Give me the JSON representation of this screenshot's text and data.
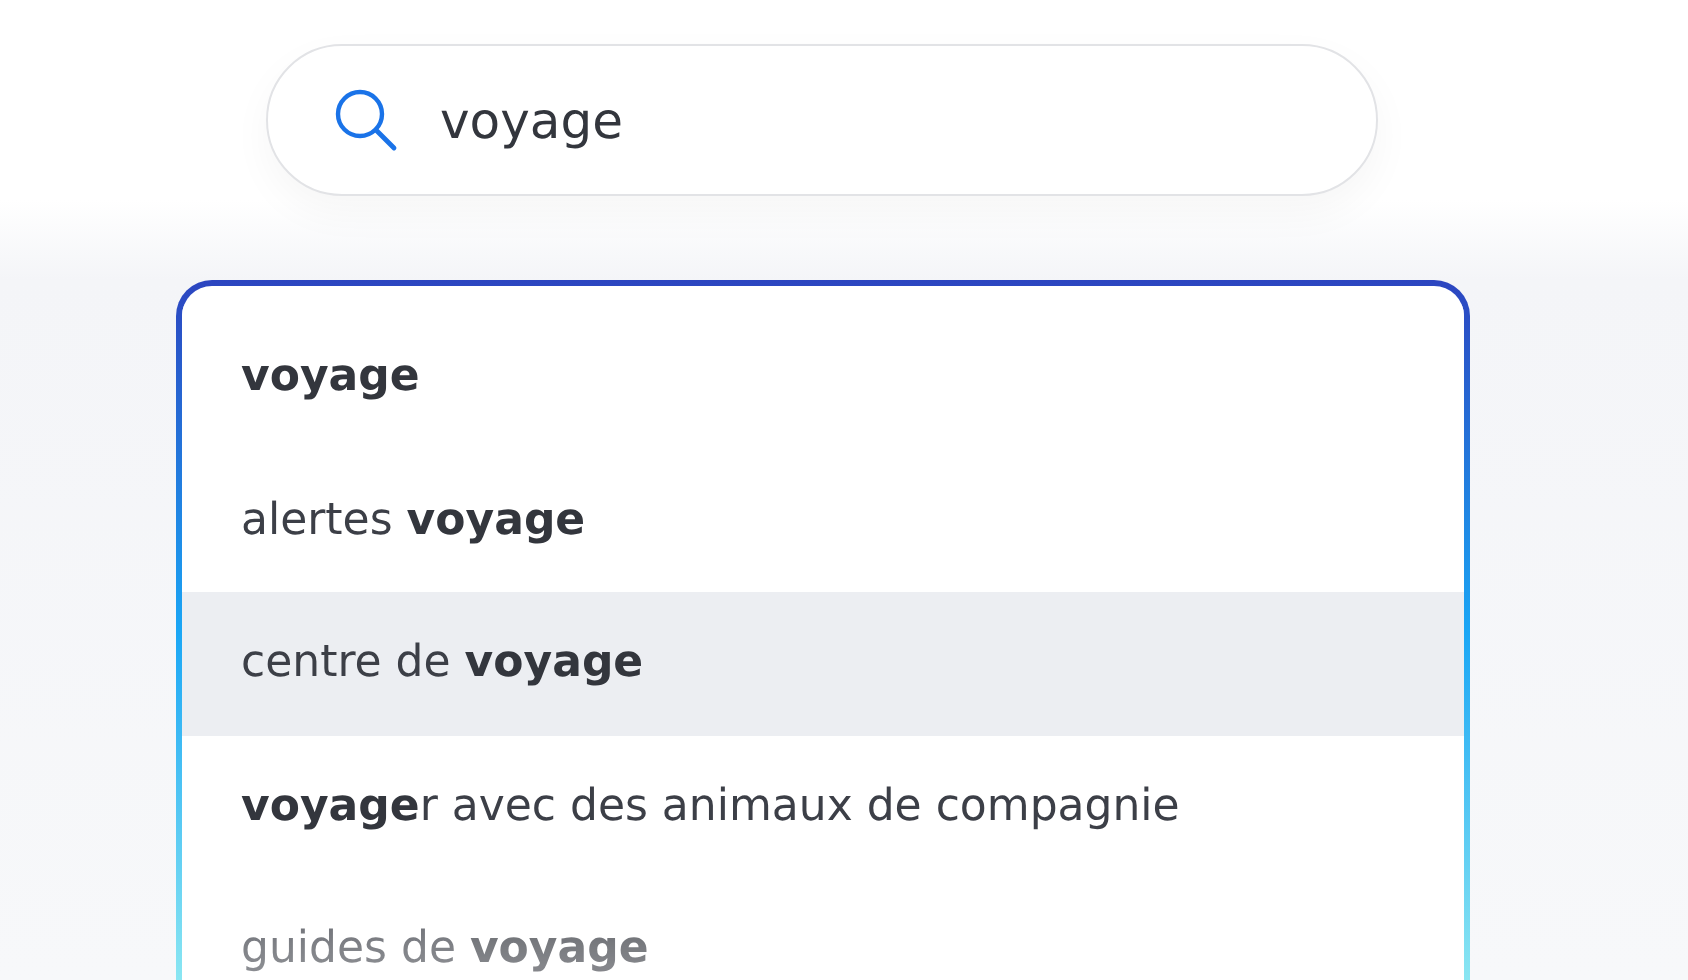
{
  "search": {
    "value": "voyage"
  },
  "suggestions": [
    {
      "text": "**voyage**",
      "selected": false
    },
    {
      "text": "alertes **voyage**",
      "selected": false
    },
    {
      "text": "centre de **voyage**",
      "selected": true
    },
    {
      "text": "**voyage**r avec des animaux de compagnie",
      "selected": false
    },
    {
      "text": "guides de **voyage**",
      "selected": false
    }
  ]
}
